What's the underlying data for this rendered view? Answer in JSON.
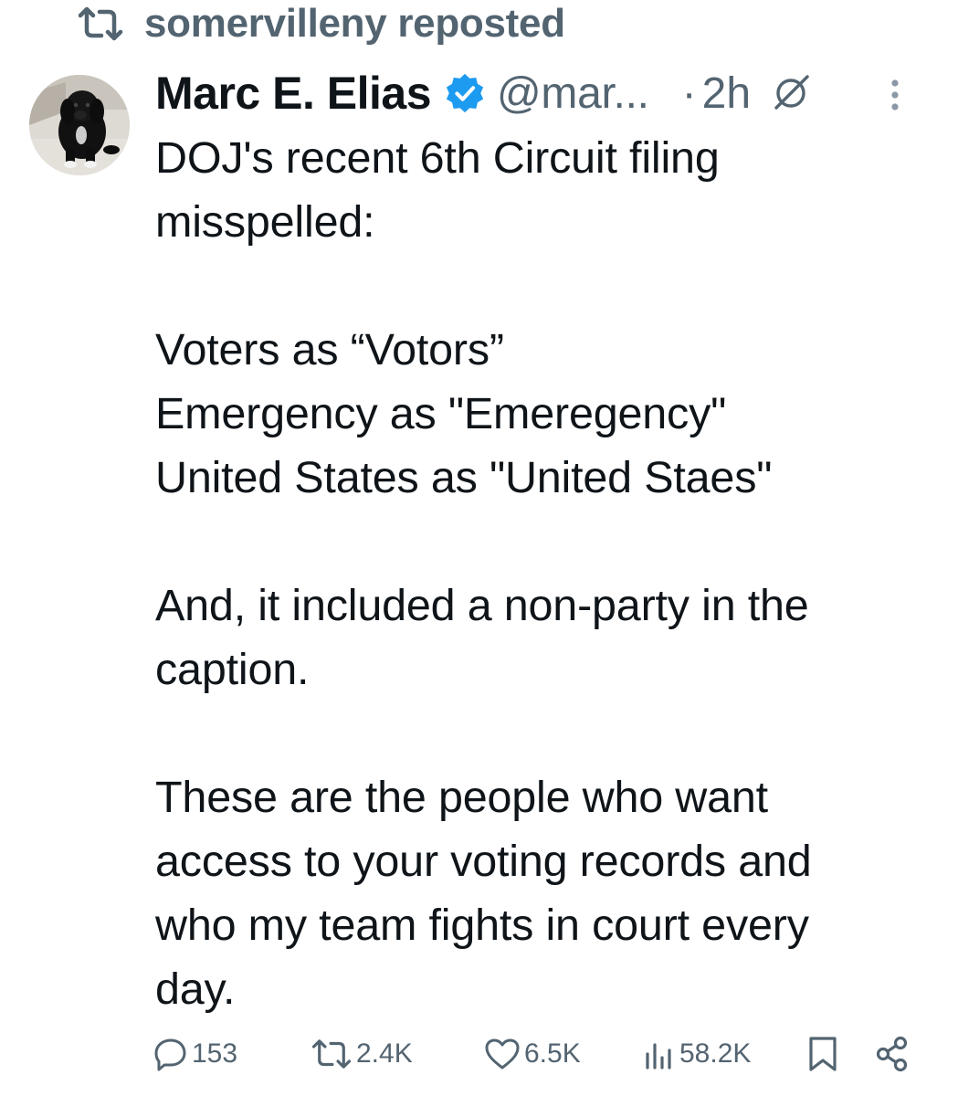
{
  "repost": {
    "label": "somervilleny reposted",
    "icon": "repost-icon"
  },
  "post": {
    "author": {
      "display_name": "Marc E. Elias",
      "handle": "@mar...",
      "verified": true,
      "verified_color": "#1d9bf0",
      "avatar": "dog-avatar"
    },
    "separator": "·",
    "time": "2h",
    "lines": [
      "DOJ's recent 6th Circuit filing",
      "misspelled:",
      "",
      "Voters as “Votors”",
      "Emergency as \"Emeregency\"",
      "United States as \"United Staes\"",
      "",
      "And, it included a non-party in the",
      "caption.",
      "",
      "These are the people who want",
      "access to your voting records and",
      "who my team fights in court every",
      "day."
    ]
  },
  "actions": {
    "replies": "153",
    "reposts": "2.4K",
    "likes": "6.5K",
    "views": "58.2K"
  },
  "colors": {
    "text": "#0f1419",
    "secondary": "#536471",
    "accent": "#1d9bf0"
  }
}
